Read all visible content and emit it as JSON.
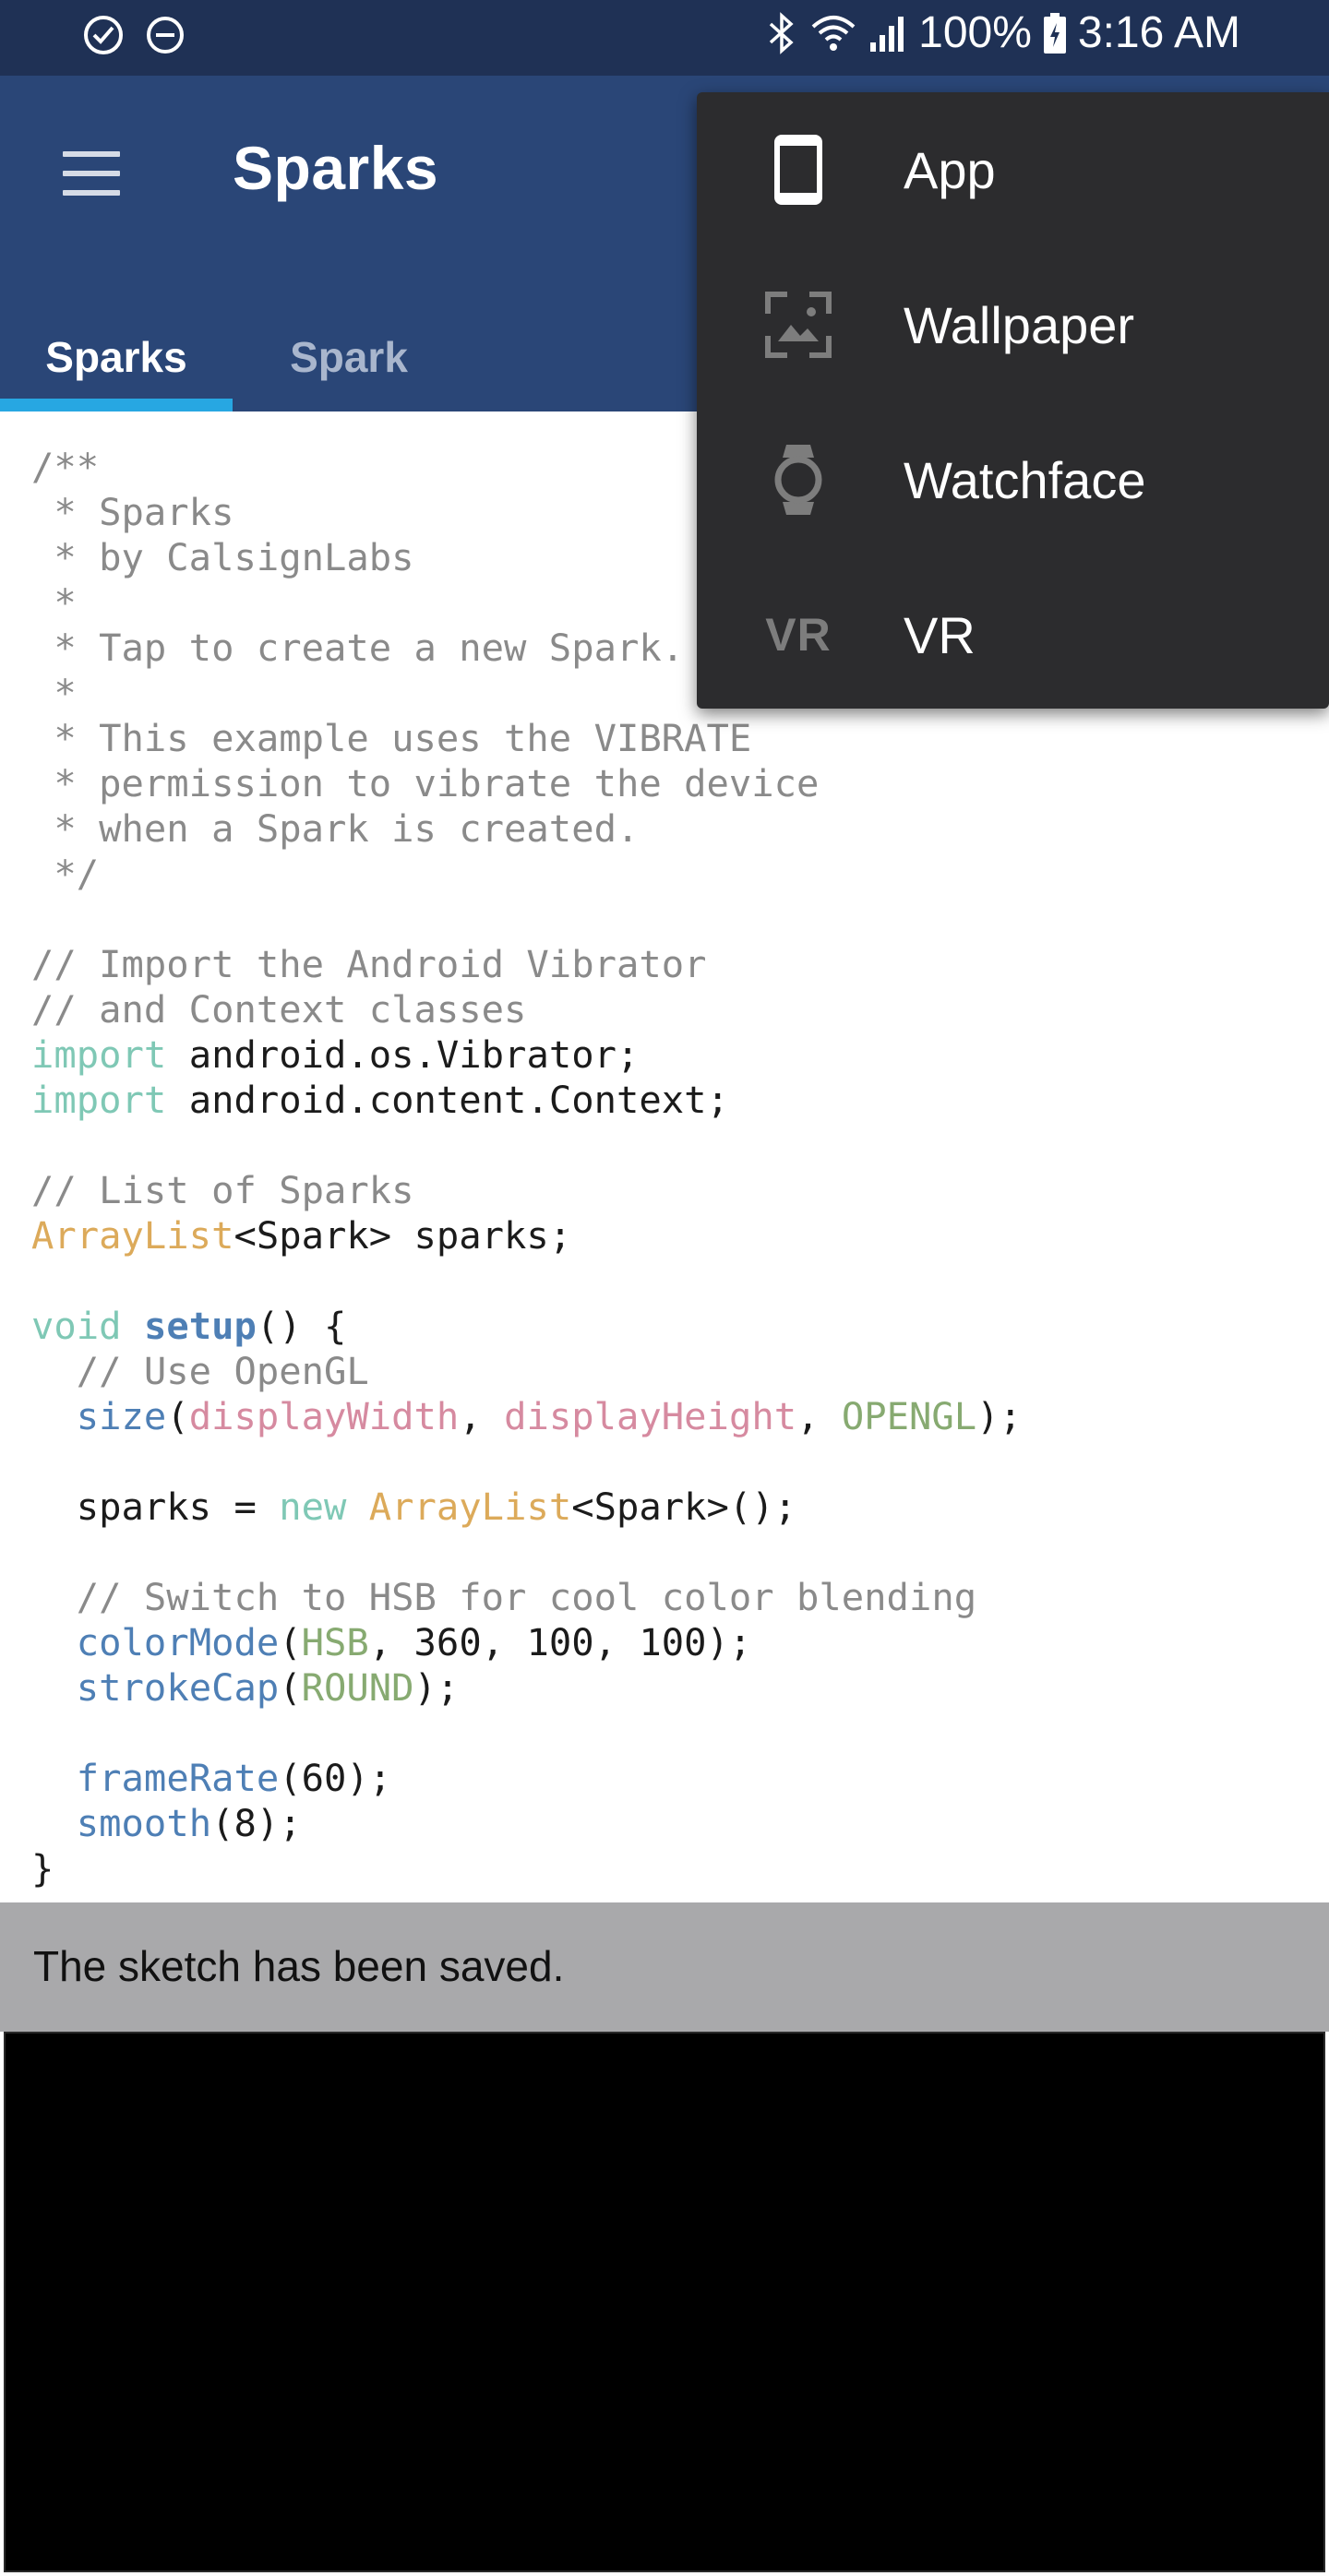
{
  "status_bar": {
    "icons_left": [
      "check-circle-icon",
      "do-not-disturb-icon"
    ],
    "icons_right": [
      "bluetooth-icon",
      "wifi-icon",
      "signal-icon",
      "battery-charging-icon"
    ],
    "battery": "100%",
    "time": "3:16 AM"
  },
  "app_bar": {
    "menu_icon": "hamburger-menu-icon",
    "title": "Sparks"
  },
  "tabs": [
    {
      "label": "Sparks",
      "active": true
    },
    {
      "label": "Spark",
      "active": false
    }
  ],
  "code_lines": [
    "/**",
    " * Sparks",
    " * by CalsignLabs",
    " *",
    " * Tap to create a new Spark.",
    " *",
    " * This example uses the VIBRATE",
    " * permission to vibrate the device",
    " * when a Spark is created.",
    " */",
    "",
    "// Import the Android Vibrator",
    "// and Context classes",
    "import android.os.Vibrator;",
    "import android.content.Context;",
    "",
    "// List of Sparks",
    "ArrayList<Spark> sparks;",
    "",
    "void setup() {",
    "  // Use OpenGL",
    "  size(displayWidth, displayHeight, OPENGL);",
    "",
    "  sparks = new ArrayList<Spark>();",
    "",
    "  // Switch to HSB for cool color blending",
    "  colorMode(HSB, 360, 100, 100);",
    "  strokeCap(ROUND);",
    "",
    "  frameRate(60);",
    "  smooth(8);",
    "}"
  ],
  "snackbar": {
    "message": "The sketch has been saved."
  },
  "dropdown": {
    "items": [
      {
        "label": "App",
        "icon": "phone-icon"
      },
      {
        "label": "Wallpaper",
        "icon": "wallpaper-icon"
      },
      {
        "label": "Watchface",
        "icon": "watch-icon"
      },
      {
        "label": "VR",
        "icon": "vr-icon",
        "icon_text": "VR"
      }
    ]
  },
  "colors": {
    "status_bar": "#1f3155",
    "app_bar": "#2a4677",
    "tab_indicator": "#27a7e2",
    "dropdown_bg": "#2c2c2e",
    "snackbar_bg": "#a9a9ab",
    "console_bg": "#000000",
    "syntax_comment": "#8a8a8a",
    "syntax_keyword": "#7fc8b5",
    "syntax_type": "#dcaa5a",
    "syntax_function": "#4e7fb5",
    "syntax_constant_pink": "#d68aa0",
    "syntax_constant_green": "#87aa71"
  }
}
